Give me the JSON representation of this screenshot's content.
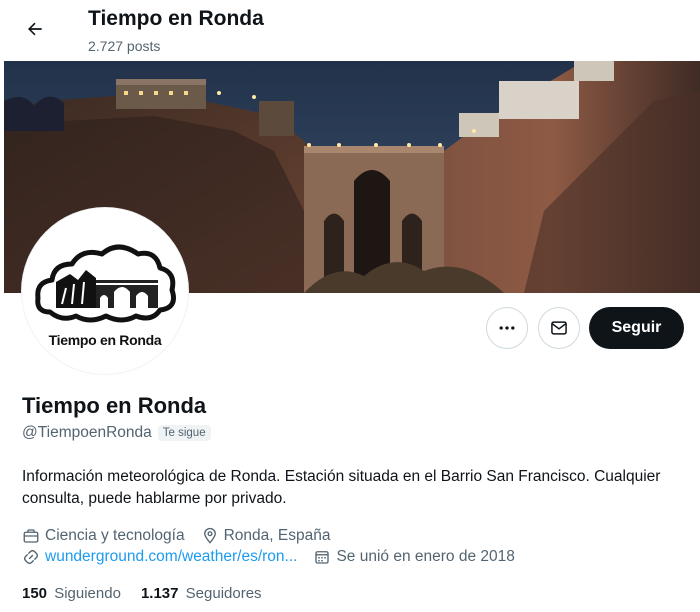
{
  "header": {
    "title": "Tiempo en Ronda",
    "posts_count": "2.727 posts"
  },
  "banner": {
    "icon": "ronda-bridge-night-photo"
  },
  "avatar": {
    "caption": "Tiempo en Ronda",
    "icon": "cloud-bridge-logo"
  },
  "actions": {
    "more_icon": "more-dots-icon",
    "message_icon": "envelope-icon",
    "follow_label": "Seguir"
  },
  "profile": {
    "name": "Tiempo en Ronda",
    "handle": "@TiempoenRonda",
    "follows_you": "Te sigue",
    "bio": "Información meteorológica de Ronda. Estación situada en el Barrio San Francisco. Cualquier consulta, puede hablarme por privado.",
    "category": "Ciencia y tecnología",
    "location": "Ronda, España",
    "website": "wunderground.com/weather/es/ron...",
    "joined": "Se unió en enero de 2018"
  },
  "stats": {
    "following_count": "150",
    "following_label": "Siguiendo",
    "followers_count": "1.137",
    "followers_label": "Seguidores"
  },
  "colors": {
    "accent": "#1d9bf0",
    "text": "#0f1419",
    "secondary": "#536471",
    "follow_bg": "#0f1419"
  }
}
